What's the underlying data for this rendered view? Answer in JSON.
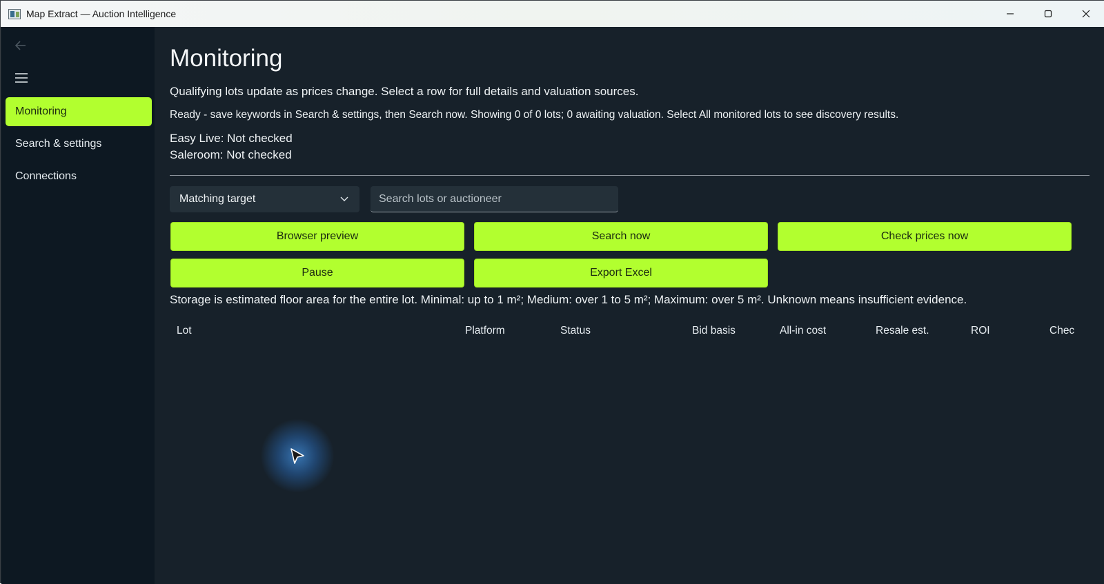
{
  "window": {
    "title": "Map Extract — Auction Intelligence",
    "controls": [
      "minimize-icon",
      "maximize-icon",
      "close-icon"
    ]
  },
  "sidebar": {
    "icons": [
      "back-arrow-icon",
      "hamburger-menu-icon"
    ],
    "items": [
      {
        "label": "Monitoring",
        "active": true
      },
      {
        "label": "Search & settings",
        "active": false
      },
      {
        "label": "Connections",
        "active": false
      }
    ]
  },
  "main": {
    "title": "Monitoring",
    "subtitle": "Qualifying lots update as prices change. Select a row for full details and valuation sources.",
    "status": "Ready - save keywords in Search & settings, then Search now.  Showing 0 of 0 lots; 0 awaiting valuation. Select All monitored lots to see discovery results.",
    "sources": [
      {
        "text": "Easy Live: Not checked"
      },
      {
        "text": "Saleroom: Not checked"
      }
    ],
    "filter": {
      "selected": "Matching target",
      "icon": "chevron-down-icon"
    },
    "search": {
      "placeholder": "Search lots or auctioneer",
      "value": ""
    },
    "buttons": {
      "browser_preview": "Browser preview",
      "search_now": "Search now",
      "check_prices": "Check prices now",
      "pause": "Pause",
      "export_excel": "Export Excel"
    },
    "storage_note": "Storage is estimated floor area for the entire lot. Minimal: up to 1 m²; Medium: over 1 to 5 m²; Maximum: over 5 m². Unknown means insufficient evidence.",
    "table": {
      "columns": [
        "Lot",
        "Platform",
        "Status",
        "Bid basis",
        "All-in cost",
        "Resale est.",
        "ROI",
        "Chec"
      ],
      "rows": []
    }
  },
  "colors": {
    "accent": "#b2ff2f",
    "background": "#17212a",
    "sidebar": "#0d1822"
  }
}
